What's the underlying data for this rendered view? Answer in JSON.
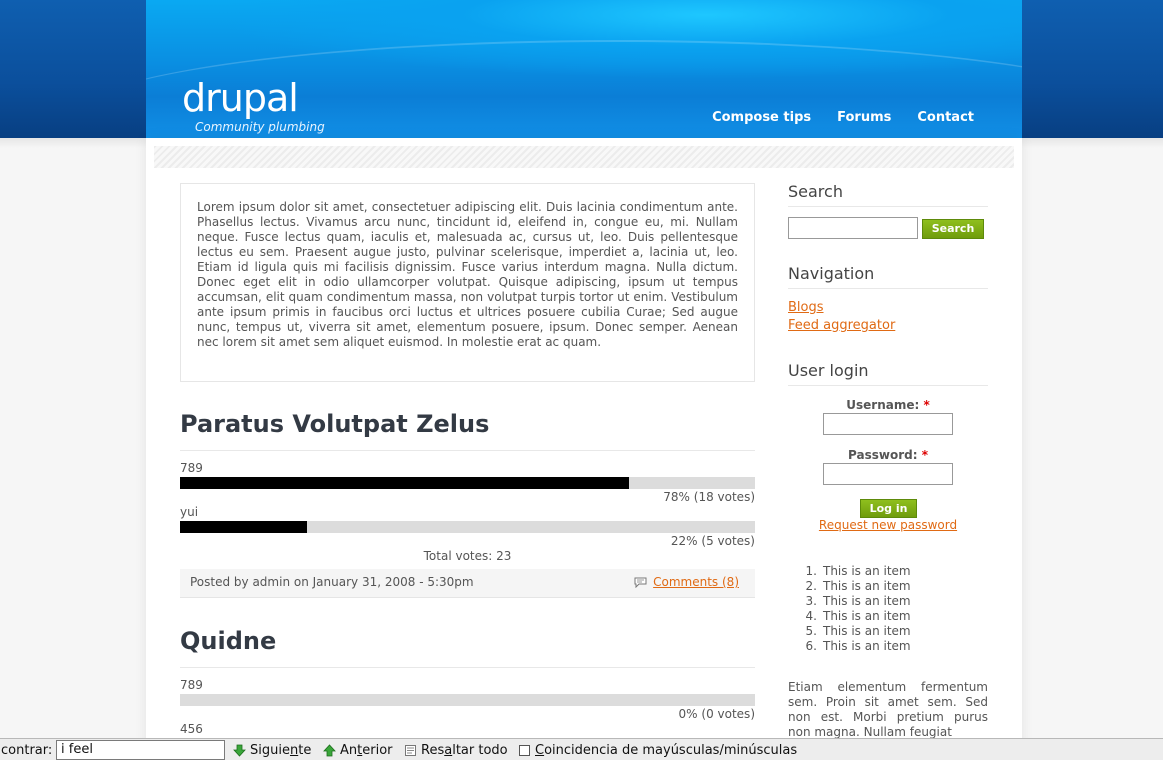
{
  "header": {
    "site_name": "drupal",
    "slogan": "Community plumbing",
    "primary_links": [
      "Compose tips",
      "Forums",
      "Contact"
    ]
  },
  "mission": "Lorem ipsum dolor sit amet, consectetuer adipiscing elit. Duis lacinia condimentum ante. Phasellus lectus. Vivamus arcu nunc, tincidunt id, eleifend in, congue eu, mi. Nullam neque. Fusce lectus quam, iaculis et, malesuada ac, cursus ut, leo. Duis pellentesque lectus eu sem. Praesent augue justo, pulvinar scelerisque, imperdiet a, lacinia ut, leo. Etiam id ligula quis mi facilisis dignissim. Fusce varius interdum magna. Nulla dictum. Donec eget elit in odio ullamcorper volutpat. Quisque adipiscing, ipsum ut tempus accumsan, elit quam condimentum massa, non volutpat turpis tortor ut enim. Vestibulum ante ipsum primis in faucibus orci luctus et ultrices posuere cubilia Curae; Sed augue nunc, tempus ut, viverra sit amet, elementum posuere, ipsum. Donec semper. Aenean nec lorem sit amet sem aliquet euismod. In molestie erat ac quam.",
  "poll1": {
    "title": "Paratus Volutpat Zelus",
    "choices": [
      {
        "label": "789",
        "fraction": 0.78,
        "percent_text": "78% (18 votes)"
      },
      {
        "label": "yui",
        "fraction": 0.22,
        "percent_text": "22% (5 votes)"
      }
    ],
    "total": "Total votes: 23",
    "posted_by": "Posted by admin on January 31, 2008 - 5:30pm",
    "comments": "Comments (8)"
  },
  "poll2": {
    "title": "Quidne",
    "choices": [
      {
        "label": "789",
        "fraction": 0,
        "percent_text": "0% (0 votes)"
      },
      {
        "label": "456"
      }
    ]
  },
  "sidebar": {
    "search_title": "Search",
    "search_button": "Search",
    "nav_title": "Navigation",
    "nav_links": [
      "Blogs",
      "Feed aggregator"
    ],
    "login_title": "User login",
    "username_label": "Username:",
    "password_label": "Password:",
    "required_mark": "*",
    "login_button": "Log in",
    "request_password": "Request new password",
    "list_items": [
      "This is an item",
      "This is an item",
      "This is an item",
      "This is an item",
      "This is an item",
      "This is an item"
    ],
    "text": "Etiam elementum fermentum sem. Proin sit amet sem. Sed non est. Morbi pretium purus non magna. Nullam feugiat"
  },
  "findbar": {
    "label": "contrar:",
    "query": "i feel",
    "next_pre": "Siguie",
    "next_key": "n",
    "next_post": "te",
    "prev_pre": "An",
    "prev_key": "t",
    "prev_post": "erior",
    "highlight_pre": "Res",
    "highlight_key": "a",
    "highlight_post": "ltar todo",
    "match_case_key": "C",
    "match_case_post": "oincidencia de mayúsculas/minúsculas",
    "colors": {
      "next_arrow": "#3aa63a",
      "prev_arrow": "#3aa63a"
    }
  }
}
